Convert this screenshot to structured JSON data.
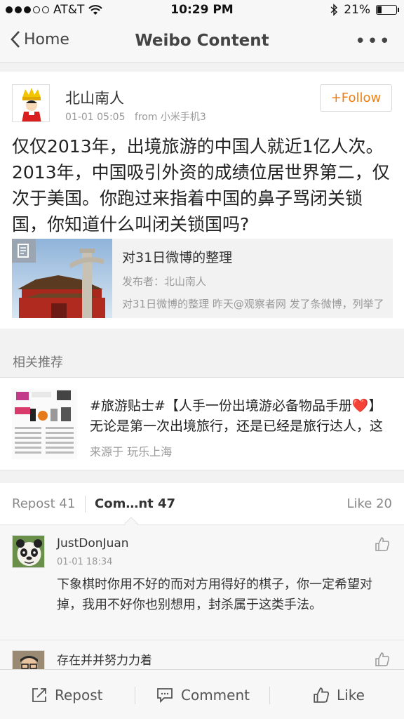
{
  "status_bar": {
    "carrier": "AT&T",
    "time": "10:29 PM",
    "battery": "21%",
    "battery_level": 0.21
  },
  "nav": {
    "back_label": "Home",
    "title": "Weibo Content"
  },
  "post": {
    "author": "北山南人",
    "time": "01-01 05:05",
    "source": "from 小米手机3",
    "follow_label": "+Follow",
    "text": "仅仅2013年，出境旅游的中国人就近1亿人次。2013年，中国吸引外资的成绩位居世界第二，仅次于美国。你跑过来指着中国的鼻子骂闭关锁国，你知道什么叫闭关锁国吗?",
    "article": {
      "title": "对31日微博的整理",
      "publisher": "发布者：北山南人",
      "description": "对31日微博的整理  昨天@观察者网 发了条微博，列举了"
    }
  },
  "related": {
    "section_title": "相关推荐",
    "text": "#旅游贴士#【人手一份出境游必备物品手册❤️】无论是第一次出境旅行，还是已经是旅行达人，这份清单都值得收藏",
    "source": "来源于 玩乐上海"
  },
  "tabs": {
    "repost": "Repost 41",
    "comment": "Com…nt 47",
    "like": "Like 20"
  },
  "comments": [
    {
      "name": "JustDonJuan",
      "time": "01-01 18:34",
      "text": "下象棋时你用不好的而对方用得好的棋子，你一定希望对掉，我用不好你也别想用，封杀属于这类手法。"
    },
    {
      "name": "存在并并努力力着"
    }
  ],
  "toolbar": {
    "repost": "Repost",
    "comment": "Comment",
    "like": "Like"
  },
  "colors": {
    "accent": "#f07e0f",
    "text": "#333333",
    "muted": "#999999",
    "background": "#f2f2f2"
  }
}
